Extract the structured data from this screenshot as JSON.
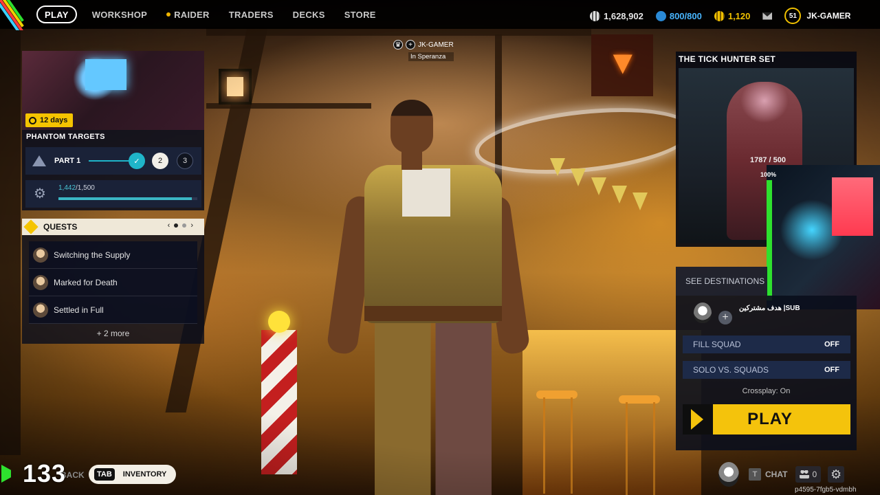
{
  "nav": {
    "items": [
      {
        "label": "PLAY",
        "active": true
      },
      {
        "label": "WORKSHOP"
      },
      {
        "label": "RAIDER",
        "dot": true
      },
      {
        "label": "TRADERS"
      },
      {
        "label": "DECKS"
      },
      {
        "label": "STORE"
      }
    ]
  },
  "currencies": [
    {
      "value": "1,628,902",
      "icon": "coins-icon",
      "color": "#e6e6e6"
    },
    {
      "value": "800/800",
      "icon": "credits-icon",
      "color": "#49b6ff"
    },
    {
      "value": "1,120",
      "icon": "raider-tokens-icon",
      "color": "#f0c000"
    }
  ],
  "profile": {
    "level": "51",
    "username": "JK-GAMER"
  },
  "player_tag": {
    "name": "JK-GAMER",
    "location": "In Speranza"
  },
  "phantom": {
    "days": "12 days",
    "title": "PHANTOM TARGETS",
    "part_label": "PART 1",
    "steps": [
      "2",
      "3"
    ],
    "xp_current": "1,442",
    "xp_total": "/1,500",
    "xp_progress": 0.96
  },
  "quests": {
    "title": "QUESTS",
    "items": [
      {
        "label": "Switching the Supply"
      },
      {
        "label": "Marked for Death"
      },
      {
        "label": "Settled in Full"
      }
    ],
    "more": "+ 2 more"
  },
  "set_card": {
    "title": "THE TICK HUNTER SET",
    "count": "1787 / 500",
    "percent": "100%"
  },
  "destinations": {
    "label": "SEE DESTINATIONS"
  },
  "squad": {
    "sub_text": "هدف مشتركين |SUB",
    "fill_squad": {
      "label": "FILL SQUAD",
      "state": "OFF"
    },
    "solo_vs_squads": {
      "label": "SOLO VS. SQUADS",
      "state": "OFF"
    },
    "crossplay": "Crossplay: On",
    "play_label": "PLAY"
  },
  "bottom": {
    "fps": "133",
    "back_text": "BACK",
    "tab_key": "TAB",
    "inventory": "INVENTORY",
    "t_key": "T",
    "chat": "CHAT",
    "friends_count": "0",
    "session_id": "p4595-7fgb5-vdmbh"
  },
  "colors": {
    "accent": "#f4c30c",
    "teal": "#1fb5c9",
    "green_overlay": "#2ee02e"
  }
}
